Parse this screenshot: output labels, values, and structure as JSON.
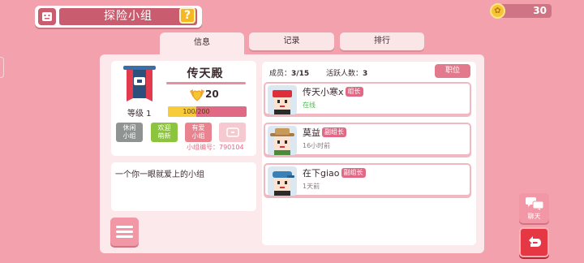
{
  "header": {
    "title": "探险小组",
    "help_label": "?"
  },
  "currency": {
    "amount": "30",
    "icon": "coin-icon"
  },
  "tabs": [
    {
      "label": "信息",
      "active": true
    },
    {
      "label": "记录",
      "active": false
    },
    {
      "label": "排行",
      "active": false
    }
  ],
  "group": {
    "name": "传天殿",
    "badge_count": "20",
    "level_label": "等级 1",
    "xp_text": "100/200",
    "xp_progress": 0.5,
    "tags": [
      {
        "label_line1": "休闲",
        "label_line2": "小组",
        "color": "#8f9493"
      },
      {
        "label_line1": "欢迎",
        "label_line2": "萌新",
        "color": "#8cc43f"
      },
      {
        "label_line1": "有爱",
        "label_line2": "小组",
        "color": "#e9838f"
      }
    ],
    "id_text": "小组编号：790104",
    "description": "一个你一眼就爱上的小组"
  },
  "stats": {
    "members_label": "成员：",
    "members_value": "3/15",
    "active_label": "活跃人数：",
    "active_value": "3",
    "position_button": "职位"
  },
  "members": [
    {
      "name": "传天小寒x",
      "role": "组长",
      "status": "在线",
      "online": true,
      "hat_color": "#e02d3a"
    },
    {
      "name": "莫益",
      "role": "副组长",
      "status": "16小时前",
      "online": false,
      "hat_color": "#c79a5a"
    },
    {
      "name": "在下giao",
      "role": "副组长",
      "status": "1天前",
      "online": false,
      "hat_color": "#3a7fb5"
    }
  ],
  "side": {
    "chat_label": "聊天"
  },
  "colors": {
    "background": "#f3a1ac",
    "accent": "#e06a86",
    "panel": "#fbe9eb"
  }
}
